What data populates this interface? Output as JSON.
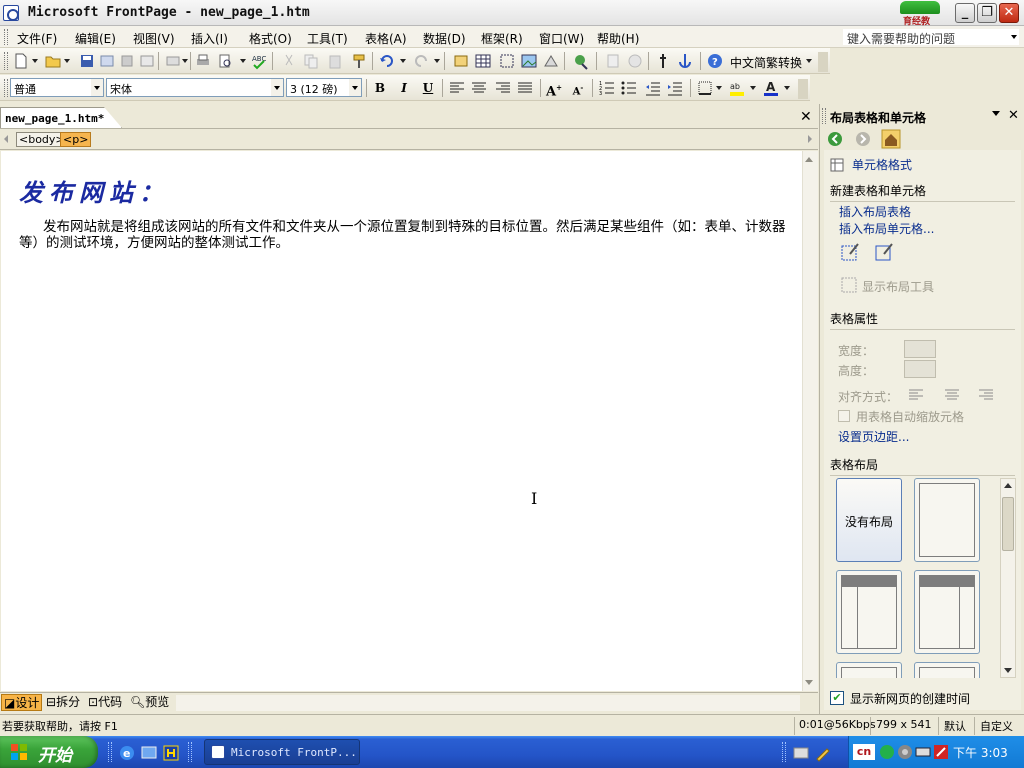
{
  "window": {
    "title": "Microsoft FrontPage - new_page_1.htm",
    "brand_logo": "育经教"
  },
  "menu": {
    "items": [
      "文件(F)",
      "编辑(E)",
      "视图(V)",
      "插入(I)",
      "格式(O)",
      "工具(T)",
      "表格(A)",
      "数据(D)",
      "框架(R)",
      "窗口(W)",
      "帮助(H)"
    ],
    "help_placeholder": "键入需要帮助的问题"
  },
  "toolbar_standard": {
    "conversion_label": "中文简繁转换"
  },
  "toolbar_format": {
    "style": "普通",
    "font": "宋体",
    "size": "3 (12 磅)"
  },
  "document": {
    "tab_label": "new_page_1.htm*",
    "tags": [
      "<body>",
      "<p>"
    ],
    "heading": "发布网站：",
    "paragraph": "发布网站就是将组成该网站的所有文件和文件夹从一个源位置复制到特殊的目标位置。然后满足某些组件（如：表单、计数器等）的测试环境，方便网站的整体测试工作。"
  },
  "view_tabs": [
    "设计",
    "拆分",
    "代码",
    "预览"
  ],
  "task_pane": {
    "title": "布局表格和单元格",
    "cell_format_link": "单元格格式",
    "section_new": "新建表格和单元格",
    "insert_table_link": "插入布局表格",
    "insert_cell_link": "插入布局单元格...",
    "show_layout_tools": "显示布局工具",
    "section_props": "表格属性",
    "width_label": "宽度：",
    "height_label": "高度：",
    "align_label": "对齐方式：",
    "autoscale_label": "用表格自动缩放元格",
    "margins_link": "设置页边距...",
    "section_layout": "表格布局",
    "no_layout": "没有布局",
    "show_creation_time": "显示新网页的创建时间"
  },
  "status": {
    "hint": "若要获取帮助，请按 F1",
    "speed": "0:01@56Kbps",
    "dimensions": "799 x 541",
    "mode1": "默认",
    "mode2": "自定义"
  },
  "taskbar": {
    "start_label": "开始",
    "task_button": "Microsoft FrontP...",
    "ime_label": "cn",
    "clock": "下午 3:03"
  },
  "colors": {
    "heading_blue": "#1b2aa1",
    "link_blue": "#0a2e8e",
    "design_tab": "#f7b447",
    "taskbar_blue": "#2455c8",
    "start_green": "#3aa43a"
  }
}
